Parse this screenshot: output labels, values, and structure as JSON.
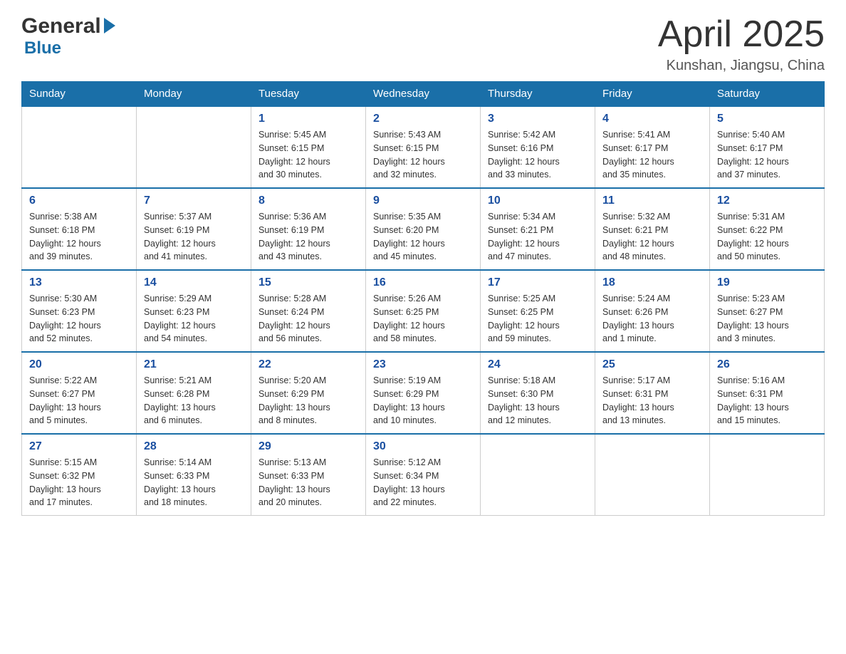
{
  "logo": {
    "general": "General",
    "blue": "Blue"
  },
  "title": "April 2025",
  "subtitle": "Kunshan, Jiangsu, China",
  "headers": [
    "Sunday",
    "Monday",
    "Tuesday",
    "Wednesday",
    "Thursday",
    "Friday",
    "Saturday"
  ],
  "weeks": [
    [
      {
        "day": "",
        "info": ""
      },
      {
        "day": "",
        "info": ""
      },
      {
        "day": "1",
        "info": "Sunrise: 5:45 AM\nSunset: 6:15 PM\nDaylight: 12 hours\nand 30 minutes."
      },
      {
        "day": "2",
        "info": "Sunrise: 5:43 AM\nSunset: 6:15 PM\nDaylight: 12 hours\nand 32 minutes."
      },
      {
        "day": "3",
        "info": "Sunrise: 5:42 AM\nSunset: 6:16 PM\nDaylight: 12 hours\nand 33 minutes."
      },
      {
        "day": "4",
        "info": "Sunrise: 5:41 AM\nSunset: 6:17 PM\nDaylight: 12 hours\nand 35 minutes."
      },
      {
        "day": "5",
        "info": "Sunrise: 5:40 AM\nSunset: 6:17 PM\nDaylight: 12 hours\nand 37 minutes."
      }
    ],
    [
      {
        "day": "6",
        "info": "Sunrise: 5:38 AM\nSunset: 6:18 PM\nDaylight: 12 hours\nand 39 minutes."
      },
      {
        "day": "7",
        "info": "Sunrise: 5:37 AM\nSunset: 6:19 PM\nDaylight: 12 hours\nand 41 minutes."
      },
      {
        "day": "8",
        "info": "Sunrise: 5:36 AM\nSunset: 6:19 PM\nDaylight: 12 hours\nand 43 minutes."
      },
      {
        "day": "9",
        "info": "Sunrise: 5:35 AM\nSunset: 6:20 PM\nDaylight: 12 hours\nand 45 minutes."
      },
      {
        "day": "10",
        "info": "Sunrise: 5:34 AM\nSunset: 6:21 PM\nDaylight: 12 hours\nand 47 minutes."
      },
      {
        "day": "11",
        "info": "Sunrise: 5:32 AM\nSunset: 6:21 PM\nDaylight: 12 hours\nand 48 minutes."
      },
      {
        "day": "12",
        "info": "Sunrise: 5:31 AM\nSunset: 6:22 PM\nDaylight: 12 hours\nand 50 minutes."
      }
    ],
    [
      {
        "day": "13",
        "info": "Sunrise: 5:30 AM\nSunset: 6:23 PM\nDaylight: 12 hours\nand 52 minutes."
      },
      {
        "day": "14",
        "info": "Sunrise: 5:29 AM\nSunset: 6:23 PM\nDaylight: 12 hours\nand 54 minutes."
      },
      {
        "day": "15",
        "info": "Sunrise: 5:28 AM\nSunset: 6:24 PM\nDaylight: 12 hours\nand 56 minutes."
      },
      {
        "day": "16",
        "info": "Sunrise: 5:26 AM\nSunset: 6:25 PM\nDaylight: 12 hours\nand 58 minutes."
      },
      {
        "day": "17",
        "info": "Sunrise: 5:25 AM\nSunset: 6:25 PM\nDaylight: 12 hours\nand 59 minutes."
      },
      {
        "day": "18",
        "info": "Sunrise: 5:24 AM\nSunset: 6:26 PM\nDaylight: 13 hours\nand 1 minute."
      },
      {
        "day": "19",
        "info": "Sunrise: 5:23 AM\nSunset: 6:27 PM\nDaylight: 13 hours\nand 3 minutes."
      }
    ],
    [
      {
        "day": "20",
        "info": "Sunrise: 5:22 AM\nSunset: 6:27 PM\nDaylight: 13 hours\nand 5 minutes."
      },
      {
        "day": "21",
        "info": "Sunrise: 5:21 AM\nSunset: 6:28 PM\nDaylight: 13 hours\nand 6 minutes."
      },
      {
        "day": "22",
        "info": "Sunrise: 5:20 AM\nSunset: 6:29 PM\nDaylight: 13 hours\nand 8 minutes."
      },
      {
        "day": "23",
        "info": "Sunrise: 5:19 AM\nSunset: 6:29 PM\nDaylight: 13 hours\nand 10 minutes."
      },
      {
        "day": "24",
        "info": "Sunrise: 5:18 AM\nSunset: 6:30 PM\nDaylight: 13 hours\nand 12 minutes."
      },
      {
        "day": "25",
        "info": "Sunrise: 5:17 AM\nSunset: 6:31 PM\nDaylight: 13 hours\nand 13 minutes."
      },
      {
        "day": "26",
        "info": "Sunrise: 5:16 AM\nSunset: 6:31 PM\nDaylight: 13 hours\nand 15 minutes."
      }
    ],
    [
      {
        "day": "27",
        "info": "Sunrise: 5:15 AM\nSunset: 6:32 PM\nDaylight: 13 hours\nand 17 minutes."
      },
      {
        "day": "28",
        "info": "Sunrise: 5:14 AM\nSunset: 6:33 PM\nDaylight: 13 hours\nand 18 minutes."
      },
      {
        "day": "29",
        "info": "Sunrise: 5:13 AM\nSunset: 6:33 PM\nDaylight: 13 hours\nand 20 minutes."
      },
      {
        "day": "30",
        "info": "Sunrise: 5:12 AM\nSunset: 6:34 PM\nDaylight: 13 hours\nand 22 minutes."
      },
      {
        "day": "",
        "info": ""
      },
      {
        "day": "",
        "info": ""
      },
      {
        "day": "",
        "info": ""
      }
    ]
  ]
}
